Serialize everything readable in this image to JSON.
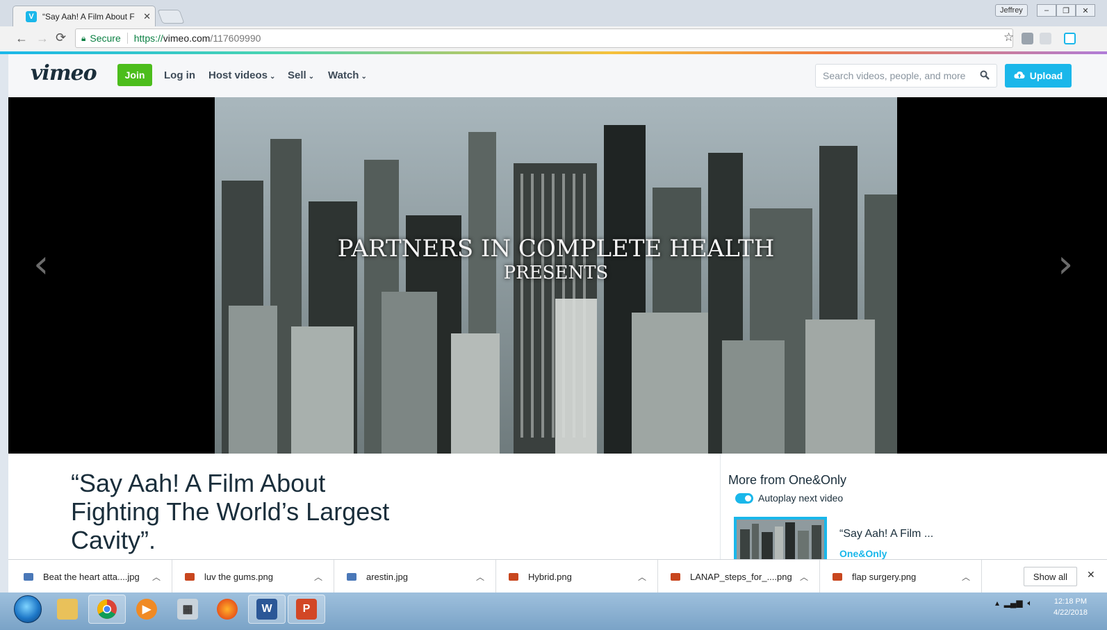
{
  "browser": {
    "tab_title": "“Say Aah! A Film About F",
    "user_label": "Jeffrey",
    "secure_label": "Secure",
    "url_scheme": "https://",
    "url_host": "vimeo.com",
    "url_path": "/117609990"
  },
  "vimeo": {
    "logo": "vimeo",
    "join_label": "Join",
    "nav": [
      "Log in",
      "Host videos",
      "Sell",
      "Watch"
    ],
    "search_placeholder": "Search videos, people, and more",
    "upload_label": "Upload"
  },
  "video": {
    "overlay_line1": "PARTNERS IN COMPLETE HEALTH",
    "overlay_line2": "PRESENTS"
  },
  "content": {
    "title": "“Say Aah! A Film About Fighting The World’s Largest Cavity”.",
    "sidebar_heading": "More from One&Only",
    "autoplay_label": "Autoplay next video",
    "related_title": "“Say Aah! A Film ...",
    "related_author": "One&Only"
  },
  "downloads": {
    "items": [
      {
        "name": "Beat the heart atta....jpg",
        "icon_color": "#4a78b8"
      },
      {
        "name": "luv the gums.png",
        "icon_color": "#c8461e"
      },
      {
        "name": "arestin.jpg",
        "icon_color": "#4a78b8"
      },
      {
        "name": "Hybrid.png",
        "icon_color": "#c8461e"
      },
      {
        "name": "LANAP_steps_for_....png",
        "icon_color": "#c8461e"
      },
      {
        "name": "flap surgery.png",
        "icon_color": "#c8461e"
      }
    ],
    "show_all_label": "Show all"
  },
  "taskbar": {
    "apps": [
      "explorer-icon",
      "chrome-icon",
      "media-player-icon",
      "calculator-icon",
      "firefox-icon",
      "word-icon",
      "powerpoint-icon"
    ],
    "time": "12:18 PM",
    "date": "4/22/2018"
  },
  "colors": {
    "vimeo_blue": "#1ab7ea",
    "join_green": "#4cbd1c",
    "vimeo_text": "#1a2e3b"
  }
}
